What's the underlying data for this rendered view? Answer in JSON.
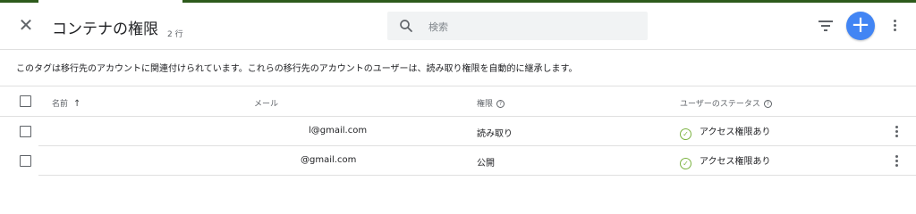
{
  "header": {
    "title": "コンテナの権限",
    "count": "2 行",
    "search_placeholder": "検索"
  },
  "notice": "このタグは移行先のアカウントに関連付けられています。これらの移行先のアカウントのユーザーは、読み取り権限を自動的に継承します。",
  "table": {
    "columns": {
      "name": "名前",
      "email": "メール",
      "permission": "権限",
      "status": "ユーザーのステータス"
    },
    "rows": [
      {
        "email": "l@gmail.com",
        "permission": "読み取り",
        "status": "アクセス権限あり"
      },
      {
        "email": "@gmail.com",
        "permission": "公開",
        "status": "アクセス権限あり"
      }
    ]
  },
  "colors": {
    "accent": "#4285f4",
    "status_ok": "#7cb342",
    "top_bar": "#2d5a1b"
  },
  "icons": [
    "close-icon",
    "search-icon",
    "filter-icon",
    "add-icon",
    "more-vert-icon",
    "help-icon",
    "sort-arrow-icon",
    "check-circle-icon"
  ]
}
